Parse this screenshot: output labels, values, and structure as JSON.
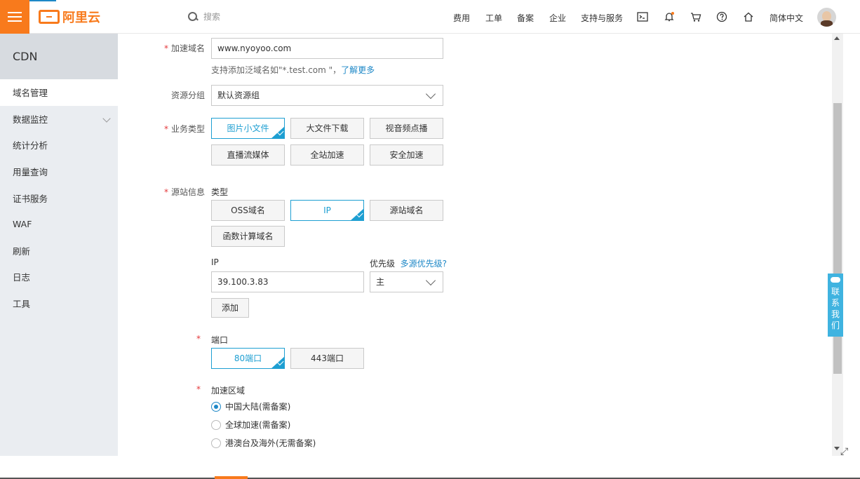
{
  "header": {
    "logo_text": "阿里云",
    "search_placeholder": "搜索",
    "nav": [
      "费用",
      "工单",
      "备案",
      "企业",
      "支持与服务"
    ],
    "language": "简体中文",
    "icons": [
      "terminal-icon",
      "bell-icon",
      "cart-icon",
      "help-icon",
      "home-icon"
    ]
  },
  "sidebar": {
    "title": "CDN",
    "items": [
      {
        "label": "域名管理",
        "active": true
      },
      {
        "label": "数据监控",
        "expandable": true
      },
      {
        "label": "统计分析"
      },
      {
        "label": "用量查询"
      },
      {
        "label": "证书服务"
      },
      {
        "label": "WAF"
      },
      {
        "label": "刷新"
      },
      {
        "label": "日志"
      },
      {
        "label": "工具"
      }
    ]
  },
  "form": {
    "domain_label": "加速域名",
    "domain_value": "www.nyoyoo.com",
    "domain_hint": "支持添加泛域名如\"*.test.com \"，",
    "domain_hint_link": "了解更多",
    "resource_group_label": "资源分组",
    "resource_group_value": "默认资源组",
    "business_type_label": "业务类型",
    "business_types": [
      "图片小文件",
      "大文件下载",
      "视音频点播",
      "直播流媒体",
      "全站加速",
      "安全加速"
    ],
    "business_type_selected": "图片小文件",
    "origin_label": "源站信息",
    "origin_type_label": "类型",
    "origin_types": [
      "OSS域名",
      "IP",
      "源站域名",
      "函数计算域名"
    ],
    "origin_type_selected": "IP",
    "ip_label": "IP",
    "ip_value": "39.100.3.83",
    "priority_label": "优先级",
    "priority_link": "多源优先级?",
    "priority_value": "主",
    "add_button": "添加",
    "port_label": "端口",
    "ports": [
      "80端口",
      "443端口"
    ],
    "port_selected": "80端口",
    "region_label": "加速区域",
    "regions": [
      "中国大陆(需备案)",
      "全球加速(需备案)",
      "港澳台及海外(无需备案)"
    ],
    "region_selected": "中国大陆(需备案)"
  },
  "contact": {
    "label": "联系我们"
  },
  "colors": {
    "brand": "#f87a1c",
    "accent": "#1e9fd2",
    "required": "#e4393c"
  }
}
